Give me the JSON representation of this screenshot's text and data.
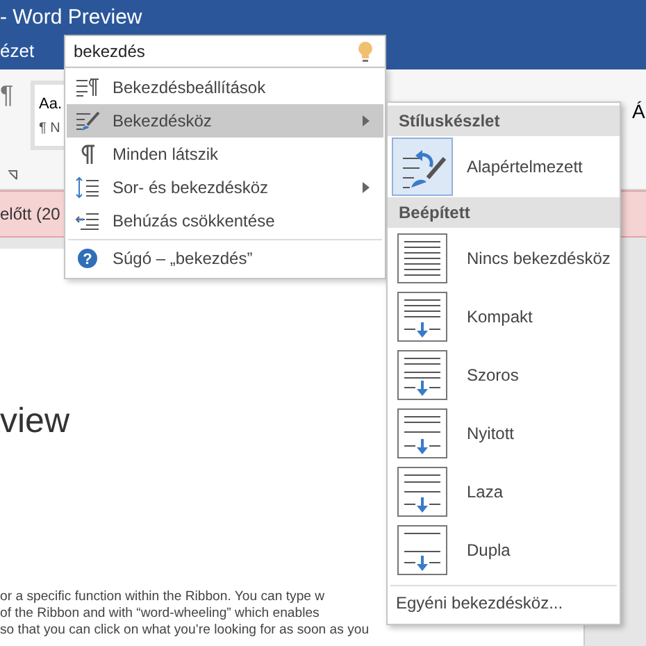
{
  "window": {
    "title": "- Word Preview"
  },
  "ribbon_tab": "ézet",
  "ribbon": {
    "gallery_sample": "Aa.",
    "gallery_label": "¶ N",
    "pilcrow": "¶",
    "style_glyph": "Á"
  },
  "message_bar": {
    "text": "előtt (20"
  },
  "document": {
    "heading": "view",
    "lines": [
      "or a specific function within the Ribbon. You can type w",
      "of the Ribbon and with “word-wheeling” which enables",
      "so that you can click on what you’re looking for as soon as you"
    ]
  },
  "search": {
    "value": "bekezdés"
  },
  "menu": [
    {
      "label": "Bekezdésbeállítások",
      "kind": "settings",
      "submenu": false,
      "selected": false
    },
    {
      "label": "Bekezdésköz",
      "kind": "spacing",
      "submenu": true,
      "selected": true
    },
    {
      "label": "Minden látszik",
      "kind": "marks",
      "submenu": false,
      "selected": false
    },
    {
      "label": "Sor- és bekezdésköz",
      "kind": "linespacing",
      "submenu": true,
      "selected": false
    },
    {
      "label": "Behúzás csökkentése",
      "kind": "indent",
      "submenu": false,
      "selected": false
    },
    {
      "label": "Súgó – „bekezdés”",
      "kind": "help",
      "icon_text": "?",
      "submenu": false,
      "selected": false
    }
  ],
  "submenu": {
    "sections": [
      {
        "header": "Stíluskészlet",
        "items": [
          {
            "label": "Alapértelmezett",
            "kind": "default",
            "selected": true
          }
        ]
      },
      {
        "header": "Beépített",
        "items": [
          {
            "label": "Nincs bekezdésköz",
            "kind": "none",
            "selected": false
          },
          {
            "label": "Kompakt",
            "kind": "compact",
            "selected": false
          },
          {
            "label": "Szoros",
            "kind": "tight",
            "selected": false
          },
          {
            "label": "Nyitott",
            "kind": "open",
            "selected": false
          },
          {
            "label": "Laza",
            "kind": "relaxed",
            "selected": false
          },
          {
            "label": "Dupla",
            "kind": "double",
            "selected": false
          }
        ]
      }
    ],
    "footer": "Egyéni bekezdésköz..."
  }
}
